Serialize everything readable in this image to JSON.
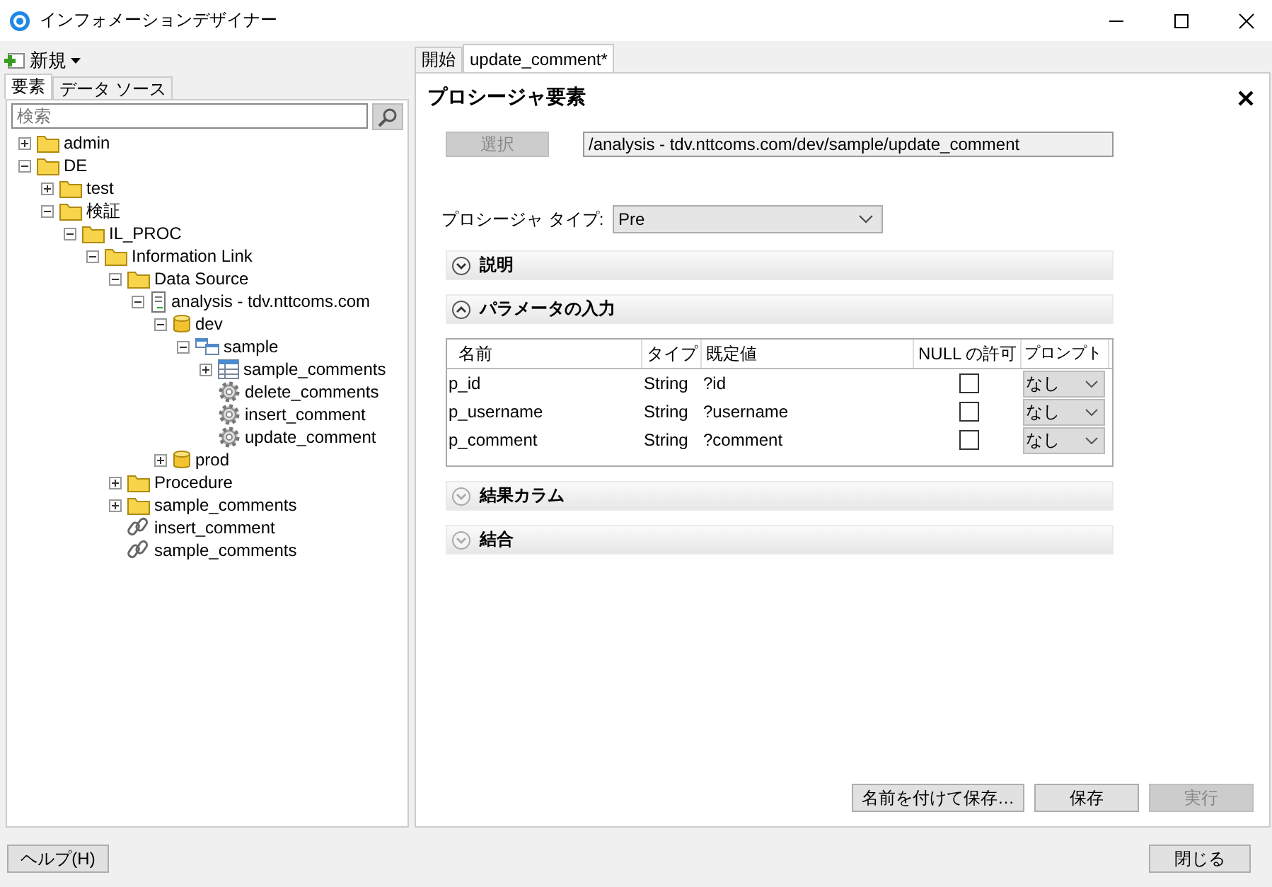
{
  "window": {
    "title": "インフォメーションデザイナー"
  },
  "toolbar": {
    "new_label": "新規"
  },
  "left_tabs": [
    {
      "label": "要素",
      "selected": true
    },
    {
      "label": "データ ソース",
      "selected": false
    }
  ],
  "search": {
    "placeholder": "検索"
  },
  "tree": [
    {
      "label": "admin",
      "kind": "folder",
      "expanded": false
    },
    {
      "label": "DE",
      "kind": "folder",
      "expanded": true,
      "children": [
        {
          "label": "test",
          "kind": "folder",
          "expanded": false
        },
        {
          "label": "検証",
          "kind": "folder",
          "expanded": true,
          "children": [
            {
              "label": "IL_PROC",
              "kind": "folder",
              "expanded": true,
              "children": [
                {
                  "label": "Information Link",
                  "kind": "folder",
                  "expanded": true,
                  "children": [
                    {
                      "label": "Data Source",
                      "kind": "folder",
                      "expanded": true,
                      "children": [
                        {
                          "label": "analysis - tdv.nttcoms.com",
                          "kind": "datasource",
                          "expanded": true,
                          "children": [
                            {
                              "label": "dev",
                              "kind": "database",
                              "expanded": true,
                              "children": [
                                {
                                  "label": "sample",
                                  "kind": "schema",
                                  "expanded": true,
                                  "children": [
                                    {
                                      "label": "sample_comments",
                                      "kind": "table",
                                      "expanded": false
                                    },
                                    {
                                      "label": "delete_comments",
                                      "kind": "procedure"
                                    },
                                    {
                                      "label": "insert_comment",
                                      "kind": "procedure"
                                    },
                                    {
                                      "label": "update_comment",
                                      "kind": "procedure"
                                    }
                                  ]
                                }
                              ]
                            },
                            {
                              "label": "prod",
                              "kind": "database",
                              "expanded": false
                            }
                          ]
                        }
                      ]
                    },
                    {
                      "label": "Procedure",
                      "kind": "folder",
                      "expanded": false
                    },
                    {
                      "label": "sample_comments",
                      "kind": "folder",
                      "expanded": false
                    },
                    {
                      "label": "insert_comment",
                      "kind": "link"
                    },
                    {
                      "label": "sample_comments",
                      "kind": "link"
                    }
                  ]
                }
              ]
            }
          ]
        }
      ]
    }
  ],
  "editor_tabs": [
    {
      "label": "開始",
      "selected": false
    },
    {
      "label": "update_comment*",
      "selected": true
    }
  ],
  "panel": {
    "title": "プロシージャ要素",
    "select_button": {
      "label": "選択",
      "disabled": true
    },
    "path": "/analysis - tdv.nttcoms.com/dev/sample/update_comment",
    "type_label": "プロシージャ タイプ:",
    "type_value": "Pre"
  },
  "sections": [
    {
      "title": "説明",
      "expanded": false,
      "disabled": false
    },
    {
      "title": "パラメータの入力",
      "expanded": true,
      "disabled": false,
      "kind": "params"
    },
    {
      "title": "結果カラム",
      "expanded": false,
      "disabled": true
    },
    {
      "title": "結合",
      "expanded": false,
      "disabled": true
    }
  ],
  "params": {
    "columns": [
      "名前",
      "タイプ",
      "既定値",
      "NULL の許可",
      "プロンプト"
    ],
    "rows": [
      {
        "name": "p_id",
        "type": "String",
        "default": "?id",
        "null_allowed": false,
        "prompt": "なし"
      },
      {
        "name": "p_username",
        "type": "String",
        "default": "?username",
        "null_allowed": false,
        "prompt": "なし"
      },
      {
        "name": "p_comment",
        "type": "String",
        "default": "?comment",
        "null_allowed": false,
        "prompt": "なし"
      }
    ]
  },
  "actions": [
    {
      "label": "名前を付けて保存…",
      "disabled": false
    },
    {
      "label": "保存",
      "disabled": false
    },
    {
      "label": "実行",
      "disabled": true
    }
  ],
  "footer": {
    "help": "ヘルプ(H)",
    "close": "閉じる"
  }
}
